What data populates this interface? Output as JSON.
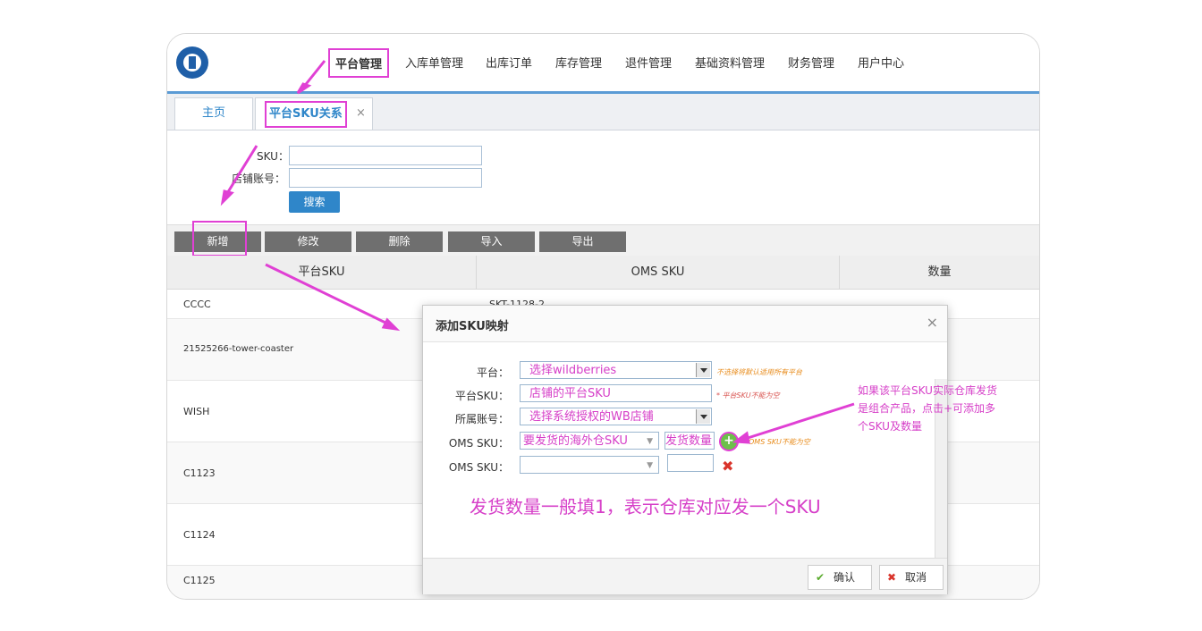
{
  "nav": {
    "items": [
      "平台管理",
      "入库单管理",
      "出库订单",
      "库存管理",
      "退件管理",
      "基础资料管理",
      "财务管理",
      "用户中心"
    ]
  },
  "tabs": {
    "home": "主页",
    "active": "平台SKU关系",
    "close": "×"
  },
  "search": {
    "sku_label": "SKU：",
    "shop_label": "店铺账号：",
    "button": "搜索"
  },
  "toolbar": {
    "add": "新增",
    "edit": "修改",
    "delete": "删除",
    "import": "导入",
    "export": "导出"
  },
  "table": {
    "headers": [
      "平台SKU",
      "OMS SKU",
      "数量"
    ],
    "rows": [
      {
        "platform_sku": "CCCC",
        "oms_sku": "SKT-1128-2"
      },
      {
        "platform_sku": "21525266-tower-coaster",
        "oms_sku": ""
      },
      {
        "platform_sku": "WISH",
        "oms_sku": ""
      },
      {
        "platform_sku": "C1123",
        "oms_sku": ""
      },
      {
        "platform_sku": "C1124",
        "oms_sku": ""
      },
      {
        "platform_sku": "C1125",
        "oms_sku": ""
      }
    ]
  },
  "dialog": {
    "title": "添加SKU映射",
    "close": "×",
    "platform_label": "平台：",
    "platform_value": "选择wildberries",
    "platform_hint": "不选择将默认适用所有平台",
    "platform_sku_label": "平台SKU：",
    "platform_sku_value": "店铺的平台SKU",
    "platform_sku_hint": "* 平台SKU不能为空",
    "account_label": "所属账号：",
    "account_value": "选择系统授权的WB店铺",
    "oms_label_1": "OMS SKU：",
    "oms_value_1": "要发货的海外仓SKU",
    "qty_value": "发货数量",
    "oms_hint": "OMS SKU不能为空",
    "oms_label_2": "OMS SKU：",
    "confirm": "确认",
    "cancel": "取消"
  },
  "annotations": {
    "combo_note_1": "如果该平台SKU实际仓库发货",
    "combo_note_2": "是组合产品，点击+可添加多",
    "combo_note_3": "个SKU及数量",
    "qty_note": "发货数量一般填1，表示仓库对应发一个SKU"
  },
  "colors": {
    "accent": "#2f86c9",
    "highlight": "#e040d4",
    "toolbar_button": "#6f6f6f"
  }
}
